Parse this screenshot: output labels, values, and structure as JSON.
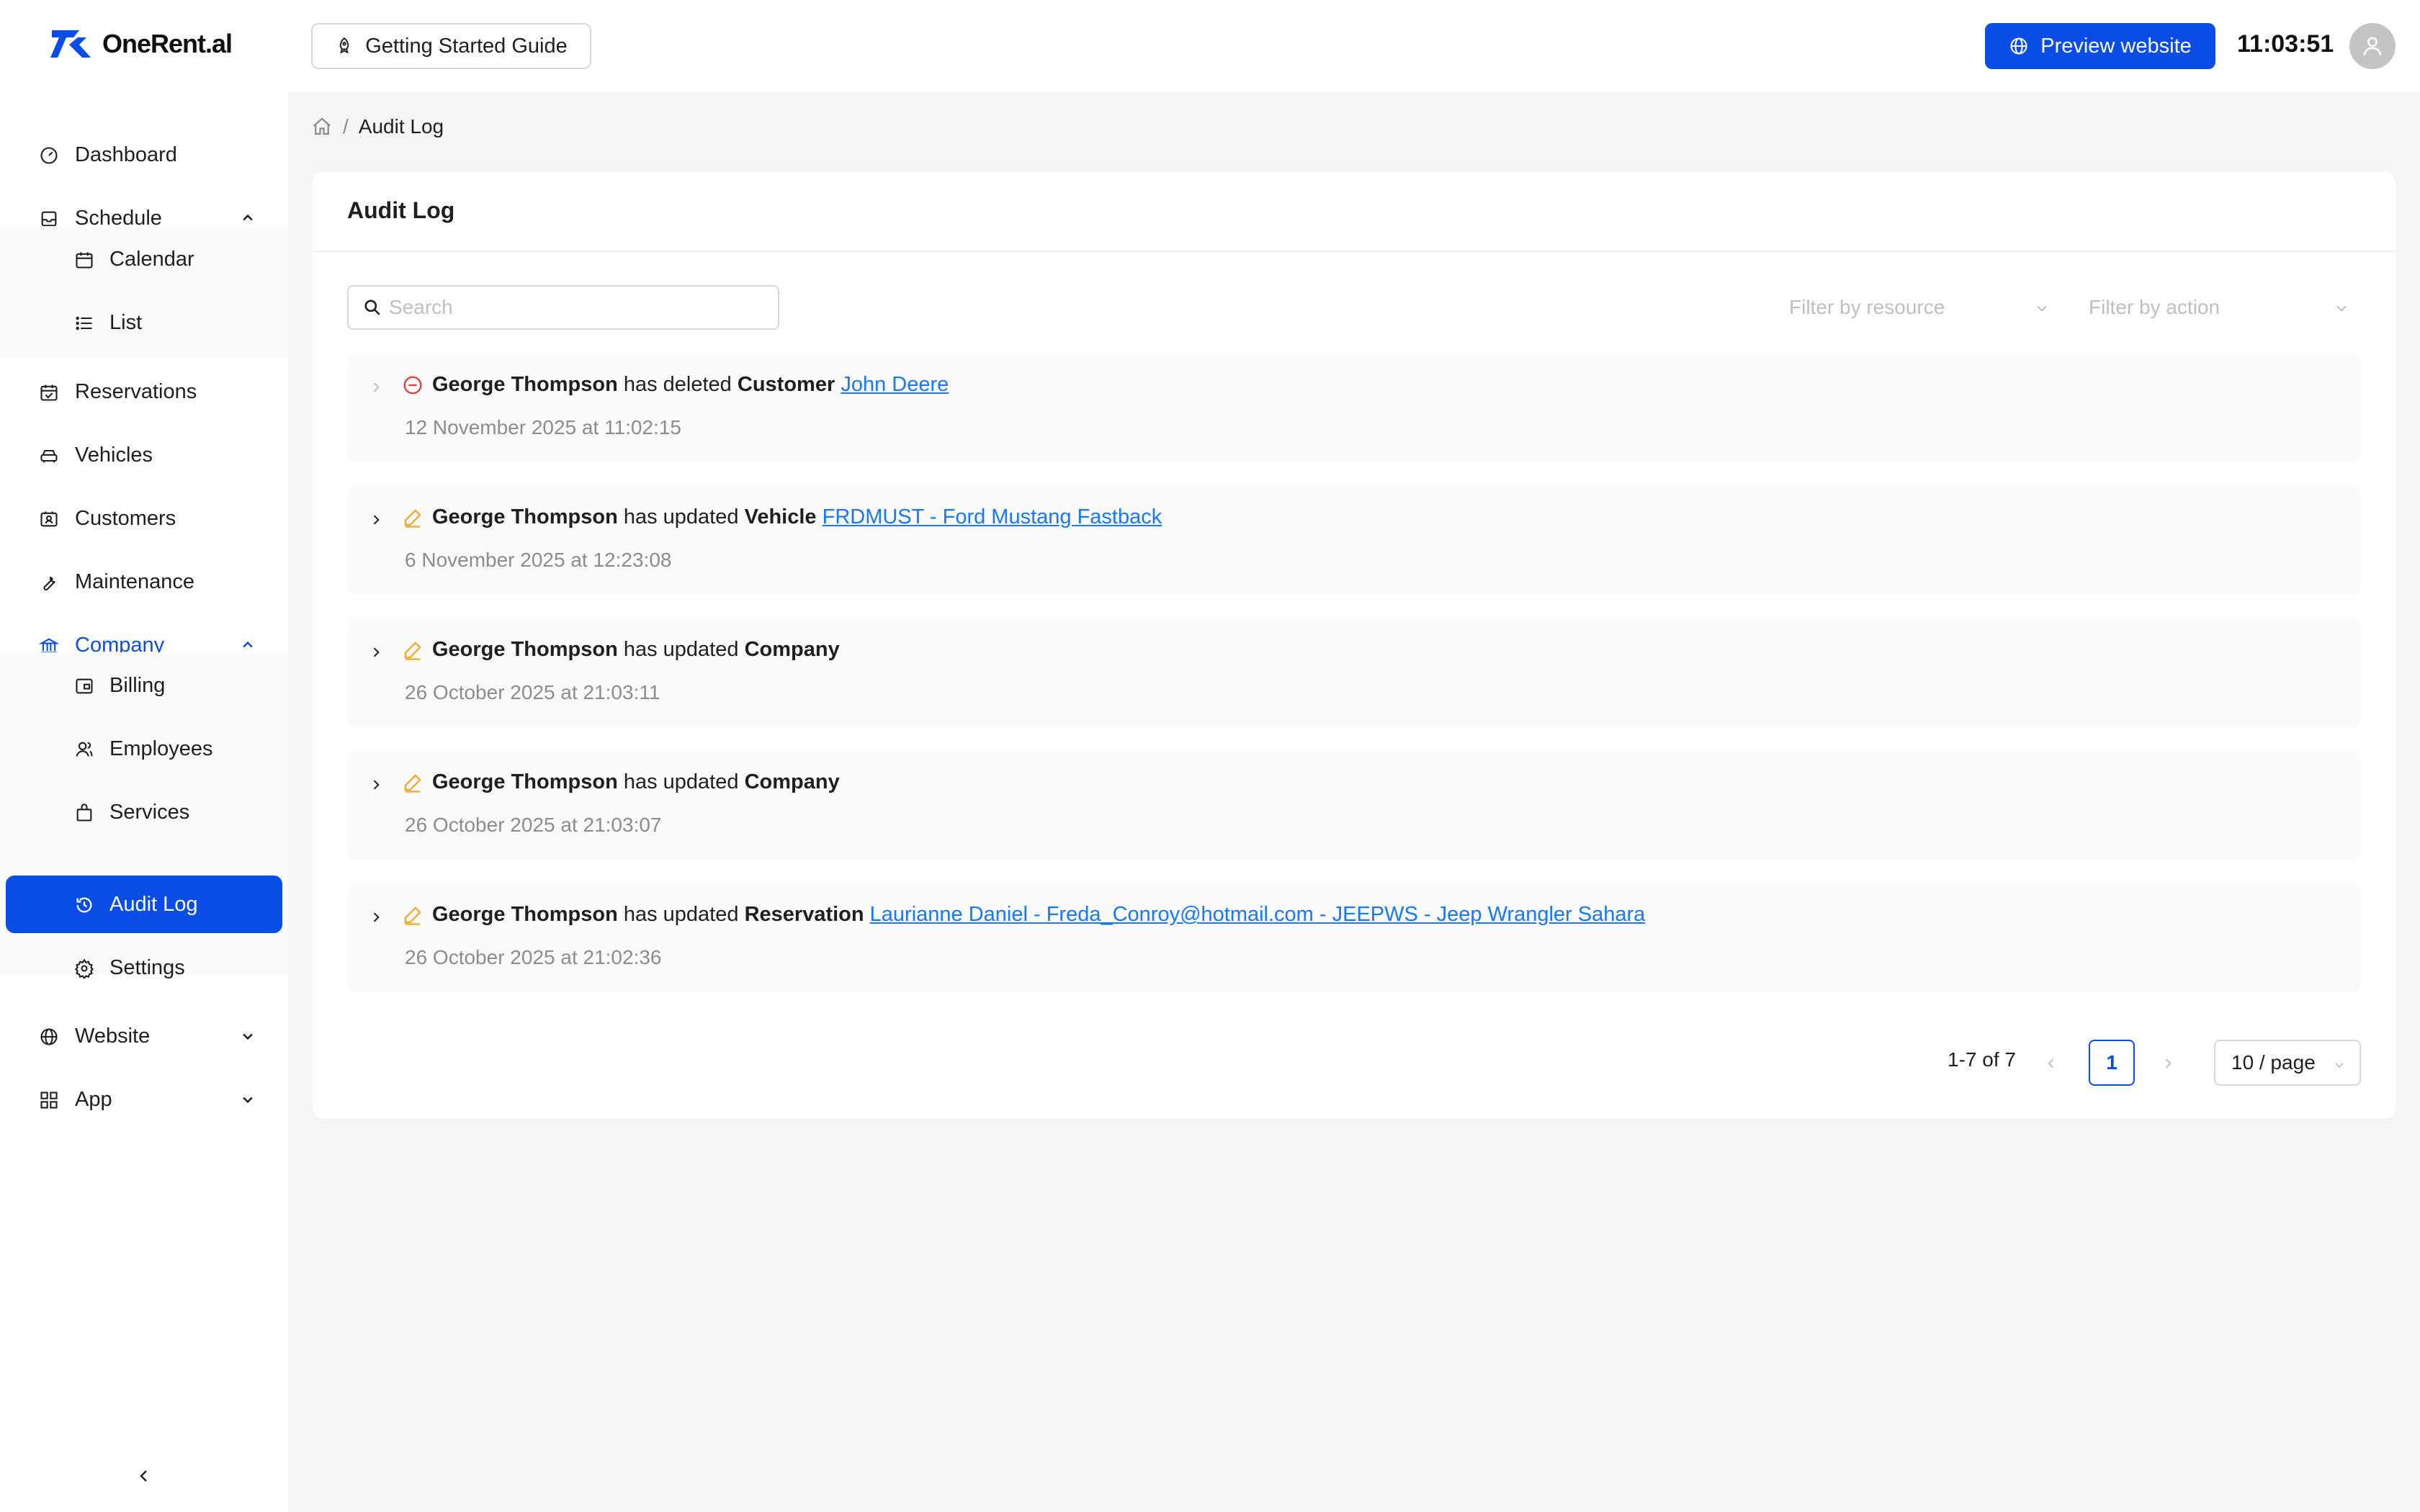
{
  "header": {
    "logo_text": "OneRent.al",
    "guide_label": "Getting Started Guide",
    "preview_label": "Preview website",
    "clock": "11:03:51"
  },
  "sidebar": {
    "items": [
      {
        "label": "Dashboard"
      },
      {
        "label": "Schedule"
      },
      {
        "label": "Calendar"
      },
      {
        "label": "List"
      },
      {
        "label": "Reservations"
      },
      {
        "label": "Vehicles"
      },
      {
        "label": "Customers"
      },
      {
        "label": "Maintenance"
      },
      {
        "label": "Company"
      },
      {
        "label": "Billing"
      },
      {
        "label": "Employees"
      },
      {
        "label": "Services"
      },
      {
        "label": "Audit Log"
      },
      {
        "label": "Settings"
      },
      {
        "label": "Website"
      },
      {
        "label": "App"
      }
    ],
    "accent": "#0a4ce6"
  },
  "breadcrumb": {
    "current": "Audit Log"
  },
  "main": {
    "title": "Audit Log",
    "search_placeholder": "Search",
    "filter_resource_placeholder": "Filter by resource",
    "filter_action_placeholder": "Filter by action"
  },
  "logs": [
    {
      "user": "George Thompson",
      "verb": "has deleted",
      "resource": "Customer",
      "link": "John Deere",
      "time": "12 November 2025 at 11:02:15",
      "action": "delete"
    },
    {
      "user": "George Thompson",
      "verb": "has updated",
      "resource": "Vehicle",
      "link": "FRDMUST - Ford Mustang Fastback",
      "time": "6 November 2025 at 12:23:08",
      "action": "update"
    },
    {
      "user": "George Thompson",
      "verb": "has updated",
      "resource": "Company",
      "link": "",
      "time": "26 October 2025 at 21:03:11",
      "action": "update"
    },
    {
      "user": "George Thompson",
      "verb": "has updated",
      "resource": "Company",
      "link": "",
      "time": "26 October 2025 at 21:03:07",
      "action": "update"
    },
    {
      "user": "George Thompson",
      "verb": "has updated",
      "resource": "Reservation",
      "link": "Laurianne Daniel - Freda_Conroy@hotmail.com - JEEPWS - Jeep Wrangler Sahara",
      "time": "26 October 2025 at 21:02:36",
      "action": "update"
    }
  ],
  "pagination": {
    "total_text": "1-7 of 7",
    "current_page": "1",
    "page_size": "10 / page"
  }
}
